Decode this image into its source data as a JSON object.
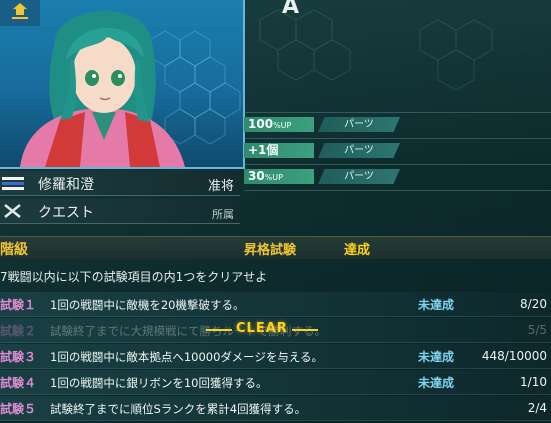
{
  "top": {
    "rank_letter": "A"
  },
  "character": {
    "name": "修羅和澄",
    "rank": "准将",
    "mission": "クエスト",
    "affiliation_label": "所属"
  },
  "bonuses": [
    {
      "value": "100",
      "unit": "%UP",
      "tag": "パーツ"
    },
    {
      "value": "+1個",
      "unit": "",
      "tag": "パーツ"
    },
    {
      "value": "30",
      "unit": "%UP",
      "tag": "パーツ"
    }
  ],
  "header": {
    "rank_label": "階級",
    "test_label": "昇格試験",
    "achieved_label": "達成"
  },
  "condition": "7戦闘以内に以下の試験項目の内1つをクリアせよ",
  "trials": [
    {
      "label": "試験１",
      "text": "1回の戦闘中に敵機を20機撃破する。",
      "status": "未達成",
      "progress": "8/20"
    },
    {
      "label": "試験２",
      "text": "試験終了までに大規模戦にて勝ちルートで勝利する。",
      "status": "",
      "progress": "5/5",
      "badge": "CLEAR"
    },
    {
      "label": "試験３",
      "text": "1回の戦闘中に敵本拠点へ10000ダメージを与える。",
      "status": "未達成",
      "progress": "448/10000"
    },
    {
      "label": "試験４",
      "text": "1回の戦闘中に銀リボンを10回獲得する。",
      "status": "未達成",
      "progress": "1/10"
    },
    {
      "label": "試験５",
      "text": "試験終了までに順位Sランクを累計4回獲得する。",
      "status": "",
      "progress": "2/4"
    }
  ],
  "colors": {
    "gold": "#f0c530",
    "status_blue": "#7ed4f0",
    "trial_label": "#d98ad0",
    "bonus_green": "#3da07f"
  }
}
